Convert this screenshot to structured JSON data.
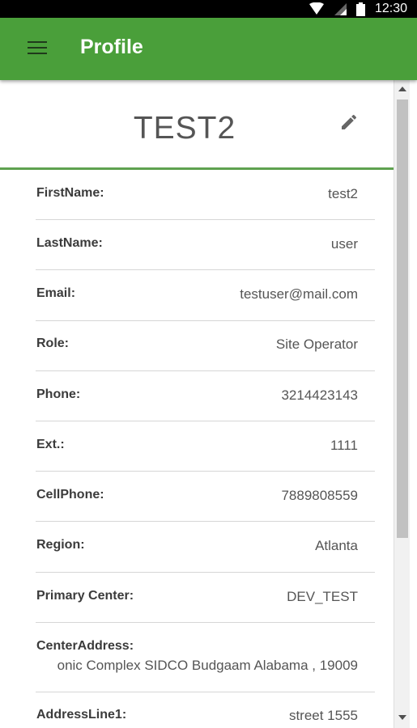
{
  "status_bar": {
    "time": "12:30",
    "icons": [
      "wifi-icon",
      "signal-icon",
      "battery-icon"
    ]
  },
  "app_bar": {
    "title": "Profile",
    "menu_icon": "menu-icon"
  },
  "profile": {
    "name": "TEST2",
    "edit_icon": "pencil-icon"
  },
  "fields": [
    {
      "label": "FirstName:",
      "value": "test2"
    },
    {
      "label": "LastName:",
      "value": "user"
    },
    {
      "label": "Email:",
      "value": "testuser@mail.com"
    },
    {
      "label": "Role:",
      "value": "Site Operator"
    },
    {
      "label": "Phone:",
      "value": "3214423143"
    },
    {
      "label": "Ext.:",
      "value": "1111"
    },
    {
      "label": "CellPhone:",
      "value": "7889808559"
    },
    {
      "label": "Region:",
      "value": "Atlanta"
    },
    {
      "label": "Primary Center:",
      "value": "DEV_TEST"
    },
    {
      "label": "CenterAddress:",
      "value": "onic Complex SIDCO Budgaam Alabama , 19009"
    },
    {
      "label": "AddressLine1:",
      "value": "street 1555"
    }
  ],
  "colors": {
    "app_bar": "#4a9f3a",
    "divider": "#5ea24f"
  }
}
